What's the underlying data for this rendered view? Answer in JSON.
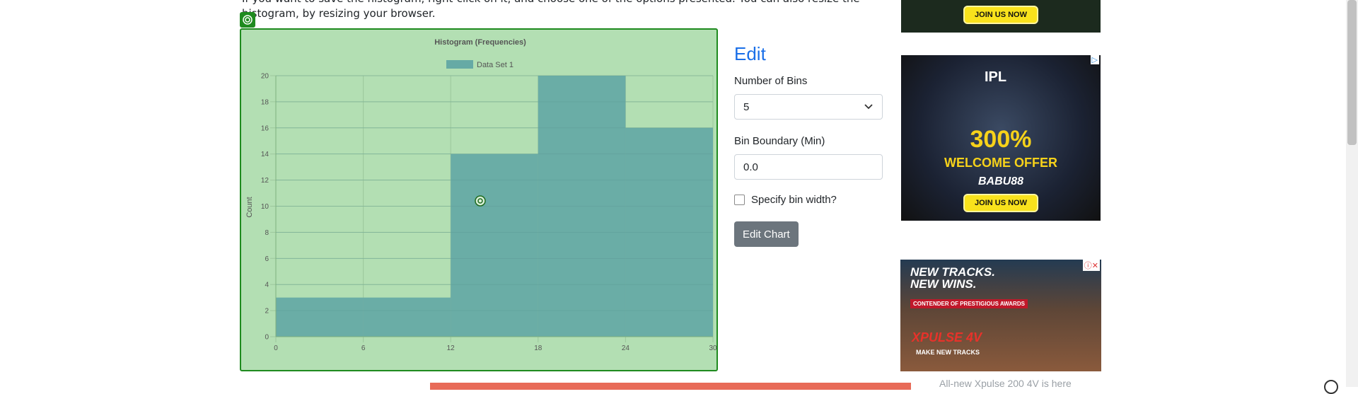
{
  "intro": {
    "text": "If you want to save the histogram, right-click on it, and choose one of the options presented. You can also resize the histogram, by resizing your browser."
  },
  "edit_panel": {
    "title": "Edit",
    "bins_label": "Number of Bins",
    "bins_value": "5",
    "boundary_label": "Bin Boundary (Min)",
    "boundary_value": "0.0",
    "bin_width_label": "Specify bin width?",
    "bin_width_checked": false,
    "edit_button": "Edit Chart"
  },
  "ads": {
    "top_cta": "JOIN US NOW",
    "ipl_logo": "IPL",
    "ipl_offer": "300%",
    "ipl_offer_sub": "WELCOME OFFER",
    "ipl_brand": "BABU88",
    "ipl_cta": "JOIN US NOW",
    "bike_head_1": "NEW TRACKS.",
    "bike_head_2": "NEW WINS.",
    "bike_strip": "CONTENDER OF PRESTIGIOUS AWARDS",
    "bike_brand": "XPULSE 4V",
    "bike_tag": "MAKE NEW TRACKS",
    "bottom_caption": "All-new Xpulse 200 4V is here"
  },
  "colors": {
    "chart_bg": "#b3dfb3",
    "chart_border": "#1f8b1f",
    "bar_fill": "#66aaa5",
    "accent": "#1a6fe8"
  },
  "chart_data": {
    "type": "bar",
    "title": "Histogram (Frequencies)",
    "legend": [
      "Data Set 1"
    ],
    "legend_position": "top",
    "xlabel": "",
    "ylabel": "Count",
    "bin_edges": [
      0,
      6,
      12,
      18,
      24,
      30
    ],
    "x_ticks": [
      "0",
      "6",
      "12",
      "18",
      "24",
      "30"
    ],
    "y_ticks": [
      "0",
      "2",
      "4",
      "6",
      "8",
      "10",
      "12",
      "14",
      "16",
      "18",
      "20"
    ],
    "series": [
      {
        "name": "Data Set 1",
        "values": [
          3,
          3,
          14,
          20,
          16
        ]
      }
    ],
    "xlim": [
      0,
      30
    ],
    "ylim": [
      0,
      20
    ],
    "grid": true
  }
}
